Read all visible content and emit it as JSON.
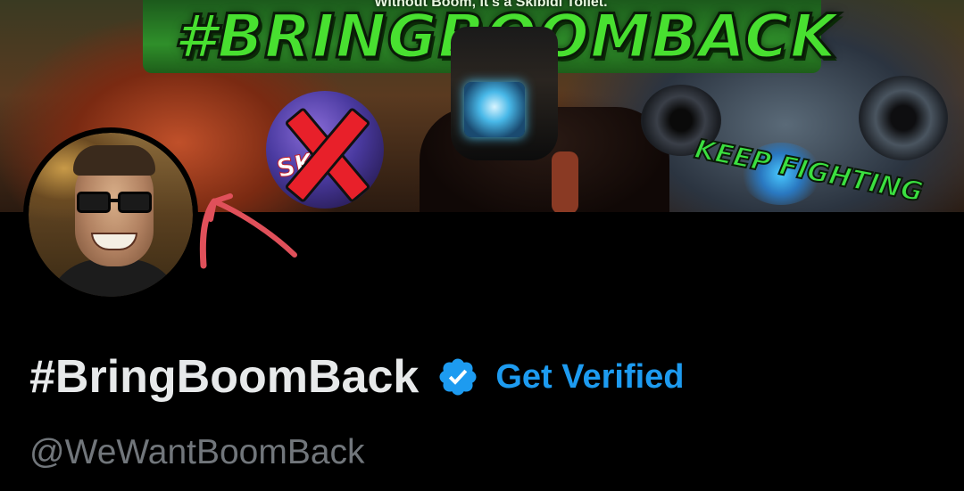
{
  "banner": {
    "tagline": "Without Boom, It's a Skibidi Toilet.",
    "hashtag": "#BRINGBOOMBACK",
    "keep_fighting": "KEEP FIGHTING",
    "crossed_logo_text": "SKI"
  },
  "avatar": {
    "icon": "profile-avatar"
  },
  "annotation": {
    "icon": "red-arrow-annotation",
    "color": "#e0505a"
  },
  "profile": {
    "display_name": "#BringBoomBack",
    "verified_icon": "verified-badge-icon",
    "get_verified_label": "Get Verified",
    "handle": "@WeWantBoomBack"
  },
  "colors": {
    "background": "#000000",
    "name_text": "#e7e9ea",
    "handle_text": "#71767b",
    "accent_blue": "#1d9bf0",
    "banner_green": "#48e030"
  }
}
